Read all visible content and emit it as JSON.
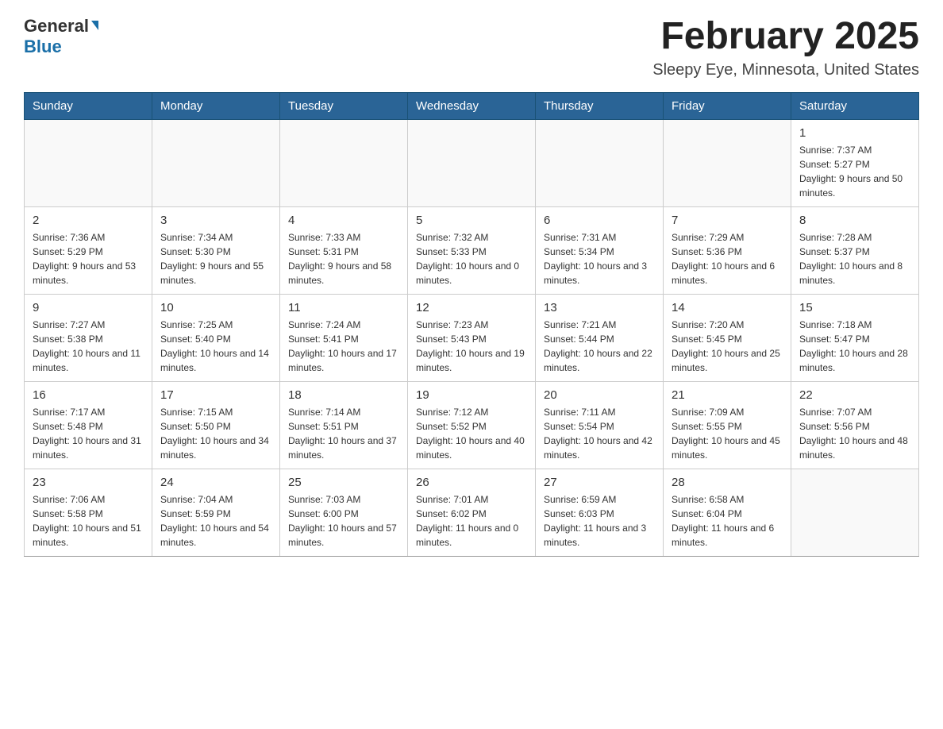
{
  "header": {
    "logo": {
      "general": "General",
      "blue": "Blue",
      "triangle": "▲"
    },
    "title": "February 2025",
    "location": "Sleepy Eye, Minnesota, United States"
  },
  "days_of_week": [
    "Sunday",
    "Monday",
    "Tuesday",
    "Wednesday",
    "Thursday",
    "Friday",
    "Saturday"
  ],
  "weeks": [
    [
      {
        "day": "",
        "info": ""
      },
      {
        "day": "",
        "info": ""
      },
      {
        "day": "",
        "info": ""
      },
      {
        "day": "",
        "info": ""
      },
      {
        "day": "",
        "info": ""
      },
      {
        "day": "",
        "info": ""
      },
      {
        "day": "1",
        "info": "Sunrise: 7:37 AM\nSunset: 5:27 PM\nDaylight: 9 hours and 50 minutes."
      }
    ],
    [
      {
        "day": "2",
        "info": "Sunrise: 7:36 AM\nSunset: 5:29 PM\nDaylight: 9 hours and 53 minutes."
      },
      {
        "day": "3",
        "info": "Sunrise: 7:34 AM\nSunset: 5:30 PM\nDaylight: 9 hours and 55 minutes."
      },
      {
        "day": "4",
        "info": "Sunrise: 7:33 AM\nSunset: 5:31 PM\nDaylight: 9 hours and 58 minutes."
      },
      {
        "day": "5",
        "info": "Sunrise: 7:32 AM\nSunset: 5:33 PM\nDaylight: 10 hours and 0 minutes."
      },
      {
        "day": "6",
        "info": "Sunrise: 7:31 AM\nSunset: 5:34 PM\nDaylight: 10 hours and 3 minutes."
      },
      {
        "day": "7",
        "info": "Sunrise: 7:29 AM\nSunset: 5:36 PM\nDaylight: 10 hours and 6 minutes."
      },
      {
        "day": "8",
        "info": "Sunrise: 7:28 AM\nSunset: 5:37 PM\nDaylight: 10 hours and 8 minutes."
      }
    ],
    [
      {
        "day": "9",
        "info": "Sunrise: 7:27 AM\nSunset: 5:38 PM\nDaylight: 10 hours and 11 minutes."
      },
      {
        "day": "10",
        "info": "Sunrise: 7:25 AM\nSunset: 5:40 PM\nDaylight: 10 hours and 14 minutes."
      },
      {
        "day": "11",
        "info": "Sunrise: 7:24 AM\nSunset: 5:41 PM\nDaylight: 10 hours and 17 minutes."
      },
      {
        "day": "12",
        "info": "Sunrise: 7:23 AM\nSunset: 5:43 PM\nDaylight: 10 hours and 19 minutes."
      },
      {
        "day": "13",
        "info": "Sunrise: 7:21 AM\nSunset: 5:44 PM\nDaylight: 10 hours and 22 minutes."
      },
      {
        "day": "14",
        "info": "Sunrise: 7:20 AM\nSunset: 5:45 PM\nDaylight: 10 hours and 25 minutes."
      },
      {
        "day": "15",
        "info": "Sunrise: 7:18 AM\nSunset: 5:47 PM\nDaylight: 10 hours and 28 minutes."
      }
    ],
    [
      {
        "day": "16",
        "info": "Sunrise: 7:17 AM\nSunset: 5:48 PM\nDaylight: 10 hours and 31 minutes."
      },
      {
        "day": "17",
        "info": "Sunrise: 7:15 AM\nSunset: 5:50 PM\nDaylight: 10 hours and 34 minutes."
      },
      {
        "day": "18",
        "info": "Sunrise: 7:14 AM\nSunset: 5:51 PM\nDaylight: 10 hours and 37 minutes."
      },
      {
        "day": "19",
        "info": "Sunrise: 7:12 AM\nSunset: 5:52 PM\nDaylight: 10 hours and 40 minutes."
      },
      {
        "day": "20",
        "info": "Sunrise: 7:11 AM\nSunset: 5:54 PM\nDaylight: 10 hours and 42 minutes."
      },
      {
        "day": "21",
        "info": "Sunrise: 7:09 AM\nSunset: 5:55 PM\nDaylight: 10 hours and 45 minutes."
      },
      {
        "day": "22",
        "info": "Sunrise: 7:07 AM\nSunset: 5:56 PM\nDaylight: 10 hours and 48 minutes."
      }
    ],
    [
      {
        "day": "23",
        "info": "Sunrise: 7:06 AM\nSunset: 5:58 PM\nDaylight: 10 hours and 51 minutes."
      },
      {
        "day": "24",
        "info": "Sunrise: 7:04 AM\nSunset: 5:59 PM\nDaylight: 10 hours and 54 minutes."
      },
      {
        "day": "25",
        "info": "Sunrise: 7:03 AM\nSunset: 6:00 PM\nDaylight: 10 hours and 57 minutes."
      },
      {
        "day": "26",
        "info": "Sunrise: 7:01 AM\nSunset: 6:02 PM\nDaylight: 11 hours and 0 minutes."
      },
      {
        "day": "27",
        "info": "Sunrise: 6:59 AM\nSunset: 6:03 PM\nDaylight: 11 hours and 3 minutes."
      },
      {
        "day": "28",
        "info": "Sunrise: 6:58 AM\nSunset: 6:04 PM\nDaylight: 11 hours and 6 minutes."
      },
      {
        "day": "",
        "info": ""
      }
    ]
  ]
}
